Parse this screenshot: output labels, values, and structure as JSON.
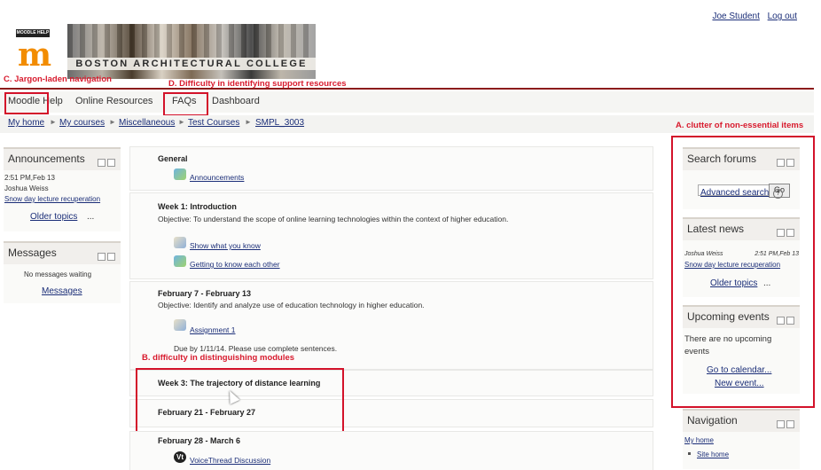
{
  "header": {
    "logo_tag": "MOODLE HELP",
    "logo_letter": "m",
    "banner_text": "BOSTON ARCHITECTURAL COLLEGE",
    "user_name": "Joe Student",
    "logout": "Log out"
  },
  "nav": {
    "items": [
      "Moodle Help",
      "Online Resources",
      "FAQs",
      "Dashboard"
    ]
  },
  "breadcrumb": [
    "My home",
    "My courses",
    "Miscellaneous",
    "Test Courses",
    "SMPL_3003"
  ],
  "left": {
    "announcements": {
      "title": "Announcements",
      "time": "2:51 PM,Feb 13",
      "author": "Joshua Weiss",
      "post": "Snow day lecture recuperation",
      "older": "Older topics",
      "ellipsis": "..."
    },
    "messages": {
      "title": "Messages",
      "none": "No messages waiting",
      "link": "Messages"
    }
  },
  "sections": {
    "general": {
      "title": "General",
      "activity": "Announcements"
    },
    "week1": {
      "title": "Week 1: Introduction",
      "objective": "Objective: To understand the scope of online learning technologies within the context of higher education.",
      "activities": [
        "Show what you know",
        "Getting to know each other"
      ]
    },
    "week2": {
      "title": "February 7 - February 13",
      "objective": "Objective: Identify and analyze use of education technology in higher education.",
      "activity": "Assignment 1",
      "note": "Due by 1/11/14. Please use complete sentences."
    },
    "week3": {
      "title": "Week 3: The trajectory of distance learning"
    },
    "week4": {
      "title": "February 21 - February 27"
    },
    "week5": {
      "title": "February 28 - March 6",
      "activity": "VoiceThread Discussion",
      "icon_letter": "Vt"
    }
  },
  "right": {
    "search": {
      "title": "Search forums",
      "go": "Go",
      "advanced": "Advanced search",
      "help": "?"
    },
    "news": {
      "title": "Latest news",
      "author": "Joshua Weiss",
      "time": "2:51 PM,Feb 13",
      "post": "Snow day lecture recuperation",
      "older": "Older topics",
      "ellipsis": "..."
    },
    "events": {
      "title": "Upcoming events",
      "none": "There are no upcoming events",
      "calendar": "Go to calendar...",
      "new_event": "New event..."
    },
    "navigation": {
      "title": "Navigation",
      "my_home": "My home",
      "site_home": "Site home"
    }
  },
  "annotations": {
    "c": "C. Jargon-laden navigation",
    "d": "D. Difficulty in identifying support resources",
    "a": "A. clutter of non-essential items",
    "b": "B. difficulty in distinguishing modules"
  },
  "colors": {
    "accent_rule": "#8c1b1b",
    "annotation_red": "#d3122a",
    "link": "#1b2e78"
  }
}
